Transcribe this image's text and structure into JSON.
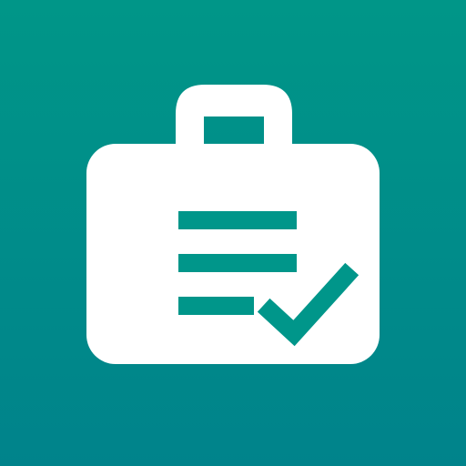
{
  "icon": {
    "name": "briefcase-checklist-icon",
    "colors": {
      "background_top": "#009688",
      "background_bottom": "#00838b",
      "glyph": "#ffffff",
      "accent": "#00968a"
    },
    "checklist_lines": 3
  }
}
